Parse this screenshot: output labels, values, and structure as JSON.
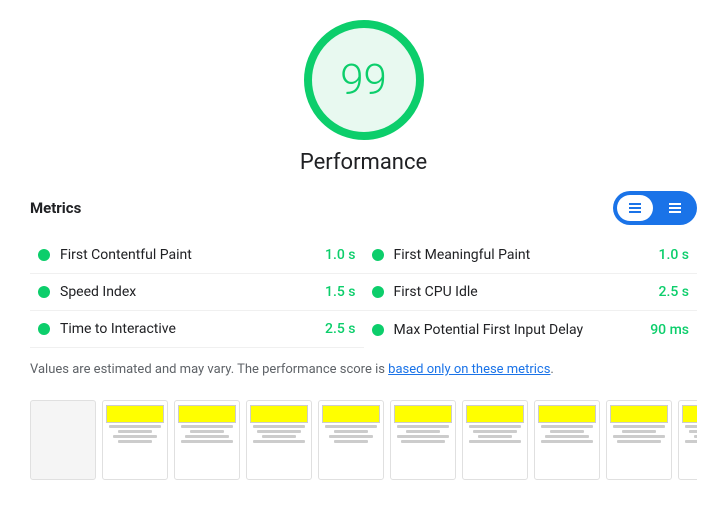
{
  "score": {
    "value": "99",
    "label": "Performance"
  },
  "metrics_header": {
    "title": "Metrics"
  },
  "metrics": [
    {
      "name": "First Contentful Paint",
      "value": "1.0 s",
      "col": 0
    },
    {
      "name": "First Meaningful Paint",
      "value": "1.0 s",
      "col": 1
    },
    {
      "name": "Speed Index",
      "value": "1.5 s",
      "col": 0
    },
    {
      "name": "First CPU Idle",
      "value": "2.5 s",
      "col": 1
    },
    {
      "name": "Time to Interactive",
      "value": "2.5 s",
      "col": 0
    },
    {
      "name": "Max Potential First Input Delay",
      "value": "90 ms",
      "col": 1
    }
  ],
  "disclaimer": {
    "text_before": "Values are estimated and may vary. The performance score is ",
    "link_text": "based only on these metrics",
    "text_after": "."
  },
  "filmstrip": {
    "frames": [
      1,
      2,
      3,
      4,
      5,
      6,
      7,
      8,
      9,
      10
    ]
  },
  "toggle": {
    "list_icon": "≡",
    "grid_icon": "⊞"
  }
}
